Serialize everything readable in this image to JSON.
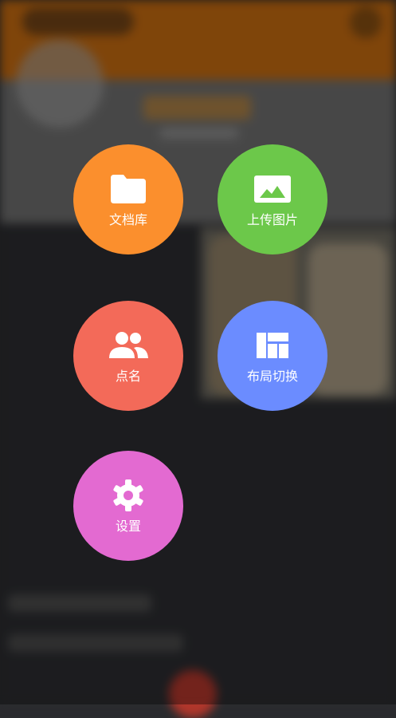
{
  "menu": {
    "items": [
      {
        "label": "文档库",
        "color": "#fb8f2d",
        "icon": "folder-icon"
      },
      {
        "label": "上传图片",
        "color": "#6cc84a",
        "icon": "image-icon"
      },
      {
        "label": "点名",
        "color": "#f36a59",
        "icon": "people-icon"
      },
      {
        "label": "布局切换",
        "color": "#6b8cff",
        "icon": "layout-icon"
      },
      {
        "label": "设置",
        "color": "#e36ad1",
        "icon": "gear-icon"
      }
    ]
  }
}
